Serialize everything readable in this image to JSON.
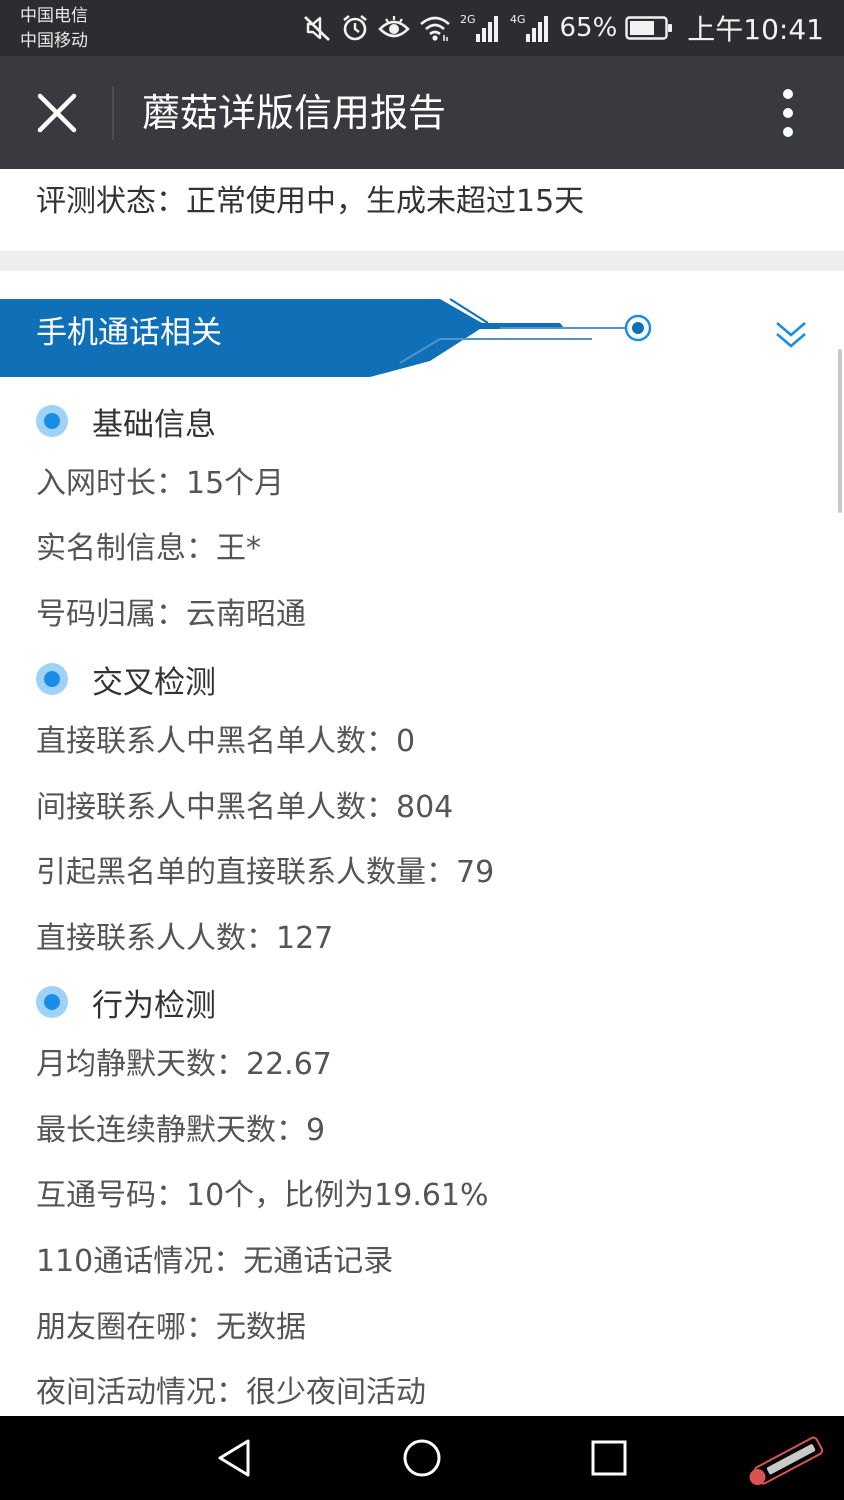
{
  "status_bar": {
    "carrier_1": "中国电信",
    "carrier_2": "中国移动",
    "network_1": "2G",
    "network_2": "4G",
    "battery_percent": "65%",
    "time": "上午10:41",
    "icons": [
      "mute-icon",
      "alarm-icon",
      "eye-icon",
      "wifi-icon",
      "signal-2g-icon",
      "signal-4g-icon",
      "battery-icon"
    ]
  },
  "title_bar": {
    "title": "蘑菇详版信用报告",
    "close_icon": "close-icon",
    "more_icon": "more-vertical-icon"
  },
  "report": {
    "status_line": "评测状态：正常使用中，生成未超过15天",
    "section": {
      "title": "手机通话相关",
      "toggle_icon": "chevron-down-icon"
    },
    "groups": [
      {
        "title": "基础信息",
        "rows": [
          "入网时长：15个月",
          "实名制信息：王*",
          "号码归属：云南昭通"
        ]
      },
      {
        "title": "交叉检测",
        "rows": [
          "直接联系人中黑名单人数：0",
          "间接联系人中黑名单人数：804",
          "引起黑名单的直接联系人数量：79",
          "直接联系人人数：127"
        ]
      },
      {
        "title": "行为检测",
        "rows": [
          "月均静默天数：22.67",
          "最长连续静默天数：9",
          "互通号码：10个，比例为19.61%",
          "110通话情况：无通话记录",
          "朋友圈在哪：无数据",
          "夜间活动情况：很少夜间活动"
        ]
      }
    ]
  },
  "nav_bar": {
    "back_icon": "back-triangle-icon",
    "home_icon": "home-circle-icon",
    "recent_icon": "recent-square-icon",
    "watermark_icon": "watermark-logo-icon"
  },
  "colors": {
    "status_bar_bg": "#2b2d30",
    "title_bar_bg": "#393a3f",
    "section_blue": "#0f70b7",
    "accent_blue": "#1a8ee6",
    "text_dark": "#333333",
    "text_gray": "#555555"
  }
}
